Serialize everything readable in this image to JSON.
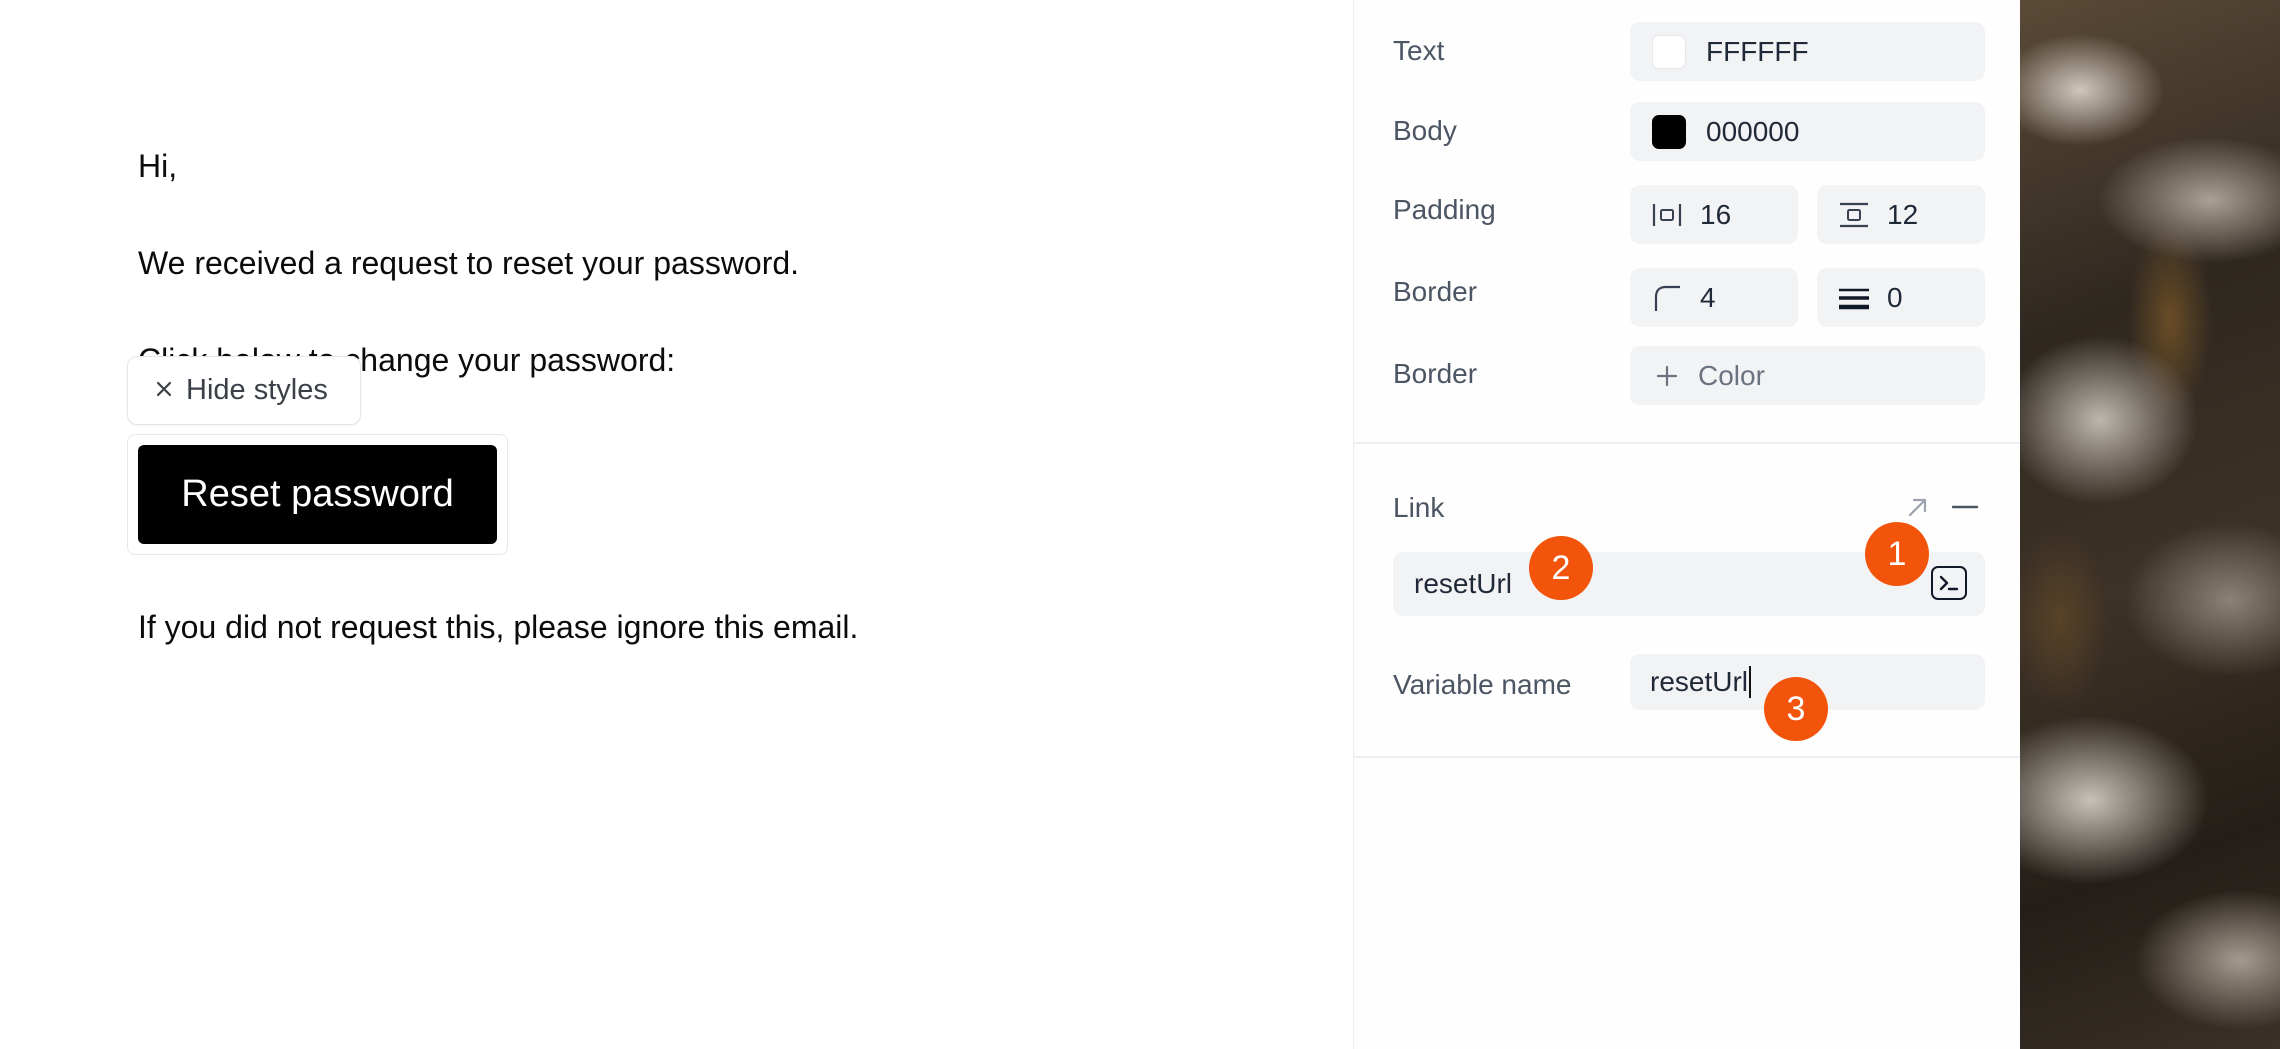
{
  "email": {
    "greeting": "Hi,",
    "line_received": "We received a request to reset your password.",
    "line_click": "Click below to change your password:",
    "button_label": "Reset password",
    "line_ignore": "If you did not request this, please ignore this email.",
    "hide_styles_label": "Hide styles"
  },
  "styles": {
    "text_label": "Text",
    "text_color": "FFFFFF",
    "body_label": "Body",
    "body_color": "000000",
    "padding_label": "Padding",
    "padding_horizontal": "16",
    "padding_vertical": "12",
    "border_label": "Border",
    "border_radius": "4",
    "border_width": "0",
    "border_color_label": "Border",
    "border_color_placeholder": "Color"
  },
  "link": {
    "section_label": "Link",
    "value": "resetUrl",
    "variable_name_label": "Variable name",
    "variable_name_value": "resetUrl"
  },
  "annotations": {
    "badge_1": "1",
    "badge_2": "2",
    "badge_3": "3"
  },
  "colors": {
    "accent_badge": "#F2540C",
    "button_bg": "#000000",
    "button_text": "#FFFFFF"
  }
}
